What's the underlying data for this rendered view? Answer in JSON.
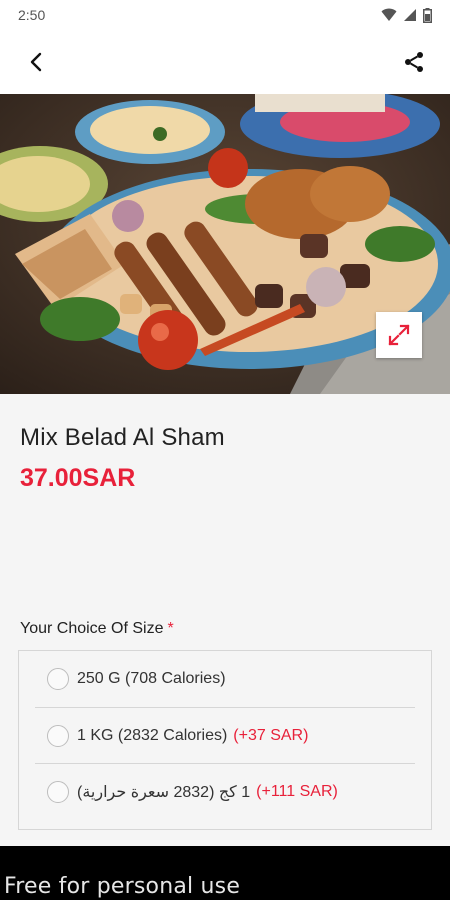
{
  "status_bar": {
    "time": "2:50",
    "wifi_icon": "wifi-icon",
    "signal_icon": "signal-icon",
    "battery_icon": "battery-icon"
  },
  "app_bar": {
    "back_icon": "back-arrow-icon",
    "share_icon": "share-icon"
  },
  "hero": {
    "image": "mixed-grill-platter-photo",
    "expand_icon": "expand-icon"
  },
  "product": {
    "name": "Mix Belad Al Sham",
    "price": "37.00SAR"
  },
  "options": {
    "title": "Your Choice Of Size",
    "required_mark": "*",
    "items": [
      {
        "label": "250 G (708 Calories)",
        "price": ""
      },
      {
        "label": "1 KG (2832 Calories)",
        "price": "(+37 SAR)"
      },
      {
        "label": "1 كج (2832 سعرة حرارية)",
        "price": "(+111 SAR)"
      }
    ]
  },
  "footer": {
    "watermark": "Free for personal use"
  },
  "colors": {
    "accent": "#e8213a",
    "background": "#f5f5f5"
  }
}
